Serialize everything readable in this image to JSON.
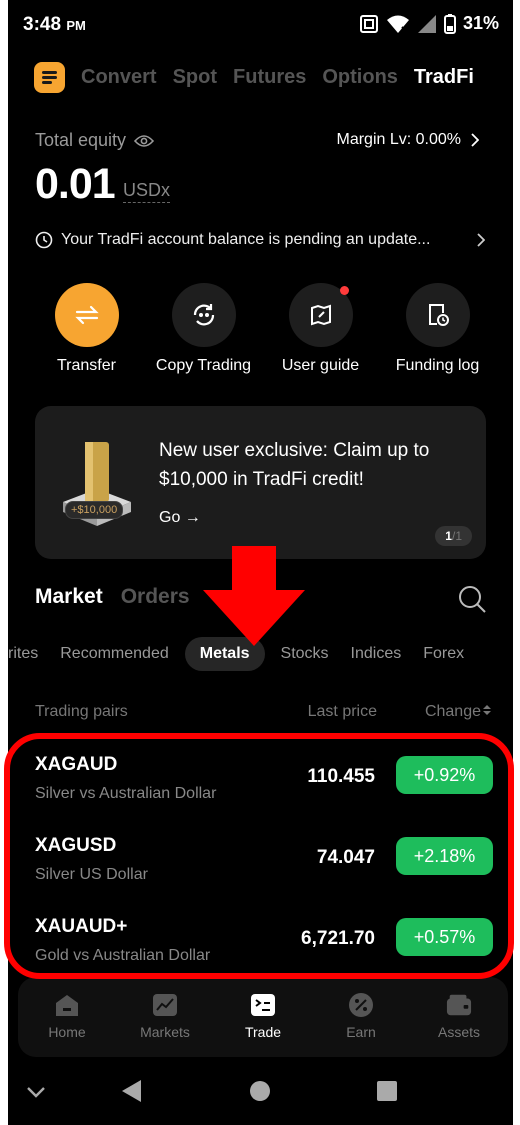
{
  "status_bar": {
    "time": "3:48",
    "ampm": "PM",
    "battery": "31%"
  },
  "top_nav": {
    "tabs": [
      "Convert",
      "Spot",
      "Futures",
      "Options",
      "TradFi"
    ],
    "active": "TradFi"
  },
  "account": {
    "equity_label": "Total equity",
    "equity_value": "0.01",
    "equity_unit": "USDx",
    "margin_level": "Margin Lv: 0.00%",
    "notice": "Your TradFi account balance is pending an update..."
  },
  "actions": [
    {
      "label": "Transfer",
      "icon": "transfer-icon"
    },
    {
      "label": "Copy Trading",
      "icon": "copy-trading-icon"
    },
    {
      "label": "User guide",
      "icon": "user-guide-icon"
    },
    {
      "label": "Funding log",
      "icon": "funding-log-icon"
    }
  ],
  "banner": {
    "title": "New user exclusive: Claim up to $10,000 in TradFi credit!",
    "cta": "Go →",
    "reward_tag": "+$10,000",
    "pager_current": "1",
    "pager_total": "/1"
  },
  "market": {
    "tabs": [
      "Market",
      "Orders"
    ],
    "subtabs": [
      "rites",
      "Recommended",
      "Metals",
      "Stocks",
      "Indices",
      "Forex"
    ],
    "selected_subtab": "Metals",
    "columns": {
      "pair": "Trading pairs",
      "price": "Last price",
      "change": "Change"
    },
    "rows": [
      {
        "symbol": "XAGAUD",
        "name": "Silver vs Australian Dollar",
        "price": "110.455",
        "change": "+0.92%"
      },
      {
        "symbol": "XAGUSD",
        "name": "Silver US Dollar",
        "price": "74.047",
        "change": "+2.18%"
      },
      {
        "symbol": "XAUAUD+",
        "name": "Gold vs Australian Dollar",
        "price": "6,721.70",
        "change": "+0.57%"
      }
    ]
  },
  "bottom_nav": [
    {
      "label": "Home",
      "icon": "home-icon"
    },
    {
      "label": "Markets",
      "icon": "markets-icon"
    },
    {
      "label": "Trade",
      "icon": "trade-icon"
    },
    {
      "label": "Earn",
      "icon": "earn-icon"
    },
    {
      "label": "Assets",
      "icon": "assets-icon"
    }
  ],
  "bottom_nav_active": "Trade",
  "colors": {
    "accent": "#f7a531",
    "positive": "#1ebd5c",
    "annotation": "#ff0000"
  }
}
